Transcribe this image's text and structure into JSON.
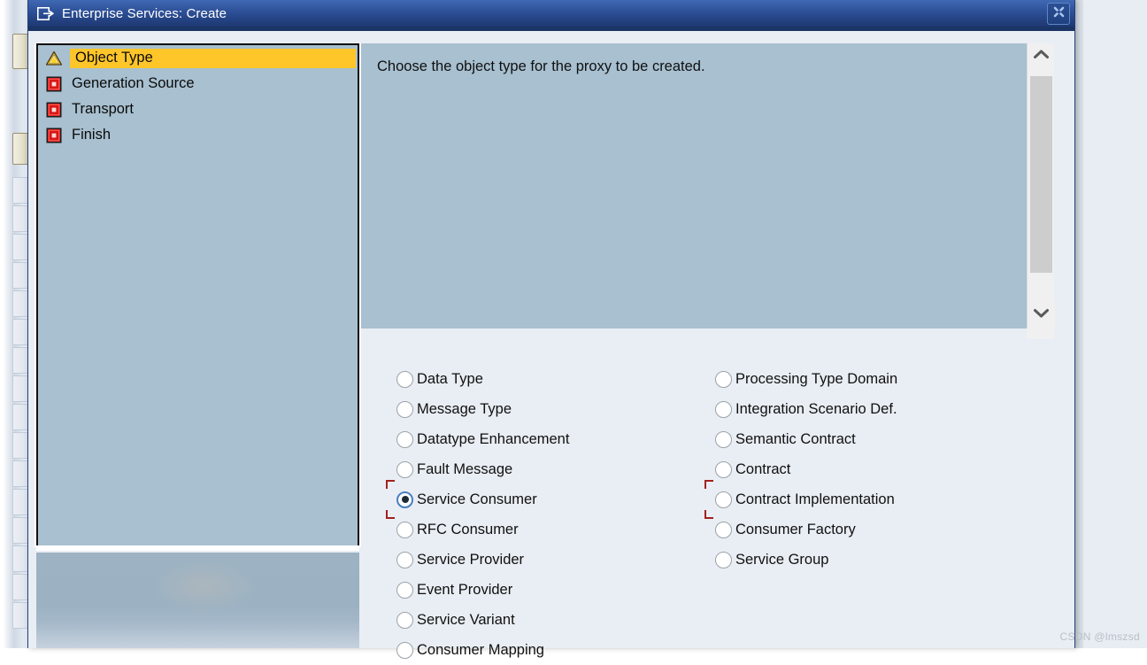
{
  "window": {
    "title": "Enterprise Services: Create",
    "title_icon": "create-object-icon",
    "close_label": "✖",
    "accent_title_bg": "#2f529a",
    "accent_highlight": "#ffc629",
    "accent_focus": "#a32020"
  },
  "sidebar": {
    "items": [
      {
        "label": "Object Type",
        "icon": "warning-triangle-icon",
        "state": "active"
      },
      {
        "label": "Generation Source",
        "icon": "stop-red-square-icon",
        "state": "pending"
      },
      {
        "label": "Transport",
        "icon": "stop-red-square-icon",
        "state": "pending"
      },
      {
        "label": "Finish",
        "icon": "stop-red-square-icon",
        "state": "pending"
      }
    ]
  },
  "info": {
    "text": "Choose the object type for the proxy to be created."
  },
  "scrollbar": {
    "up_label": "⌃",
    "down_label": "⌄"
  },
  "options": {
    "left_column": [
      {
        "label": "Data Type",
        "selected": false,
        "focused": false
      },
      {
        "label": "Message Type",
        "selected": false,
        "focused": false
      },
      {
        "label": "Datatype Enhancement",
        "selected": false,
        "focused": false
      },
      {
        "label": "Fault Message",
        "selected": false,
        "focused": false
      },
      {
        "label": "Service Consumer",
        "selected": true,
        "focused": true
      },
      {
        "label": "RFC Consumer",
        "selected": false,
        "focused": false
      },
      {
        "label": "Service Provider",
        "selected": false,
        "focused": false
      },
      {
        "label": "Event Provider",
        "selected": false,
        "focused": false
      },
      {
        "label": "Service Variant",
        "selected": false,
        "focused": false
      },
      {
        "label": "Consumer Mapping",
        "selected": false,
        "focused": false
      }
    ],
    "right_column": [
      {
        "label": "Processing Type Domain",
        "selected": false,
        "focused": false
      },
      {
        "label": "Integration Scenario Def.",
        "selected": false,
        "focused": false
      },
      {
        "label": "Semantic Contract",
        "selected": false,
        "focused": false
      },
      {
        "label": "Contract",
        "selected": false,
        "focused": false
      },
      {
        "label": "Contract Implementation",
        "selected": false,
        "focused": true
      },
      {
        "label": "Consumer Factory",
        "selected": false,
        "focused": false
      },
      {
        "label": "Service Group",
        "selected": false,
        "focused": false
      }
    ]
  },
  "watermark": {
    "text": "CSDN @lmszsd"
  }
}
